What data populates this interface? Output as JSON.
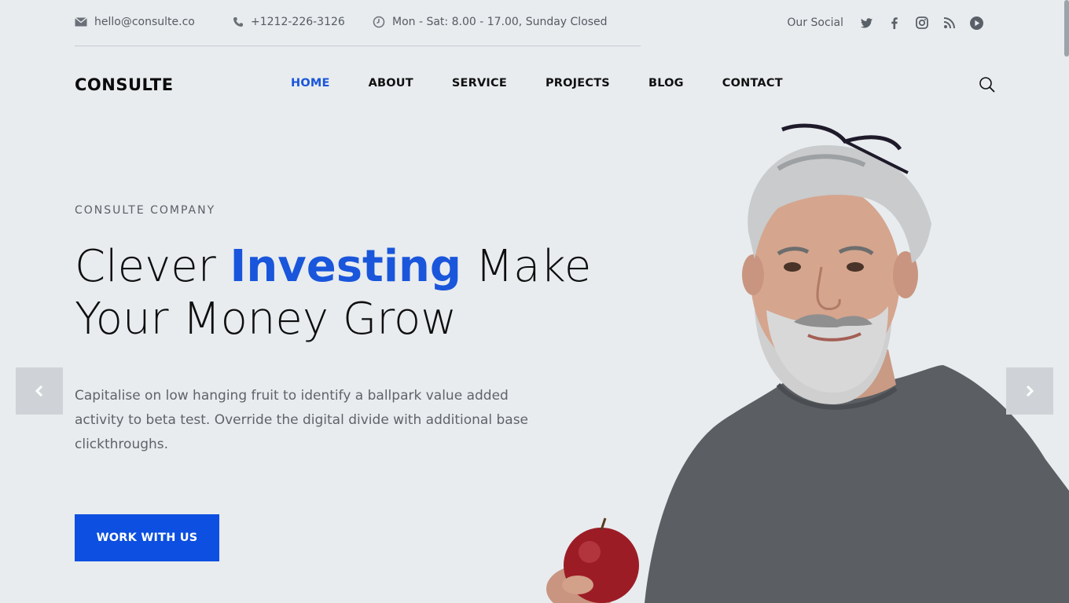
{
  "topbar": {
    "email": "hello@consulte.co",
    "phone": "+1212-226-3126",
    "hours": "Mon - Sat: 8.00 - 17.00, Sunday Closed",
    "social_label": "Our Social",
    "social_icons": [
      "twitter-icon",
      "facebook-icon",
      "instagram-icon",
      "rss-icon",
      "youtube-icon"
    ]
  },
  "header": {
    "logo": "CONSULTE",
    "nav": [
      "HOME",
      "ABOUT",
      "SERVICE",
      "PROJECTS",
      "BLOG",
      "CONTACT"
    ],
    "active_nav": "HOME"
  },
  "hero": {
    "eyebrow": "CONSULTE COMPANY",
    "headline_pre": "Clever ",
    "headline_accent": "Investing",
    "headline_post1": " Make",
    "headline_line2": "Your Money Grow",
    "description": "Capitalise on low hanging fruit to identify a ballpark value added activity to beta test. Override the digital divide with additional base clickthroughs.",
    "cta": "WORK WITH US"
  },
  "colors": {
    "accent": "#1a56db",
    "background": "#e8ecef",
    "button": "#0d4fe0"
  }
}
